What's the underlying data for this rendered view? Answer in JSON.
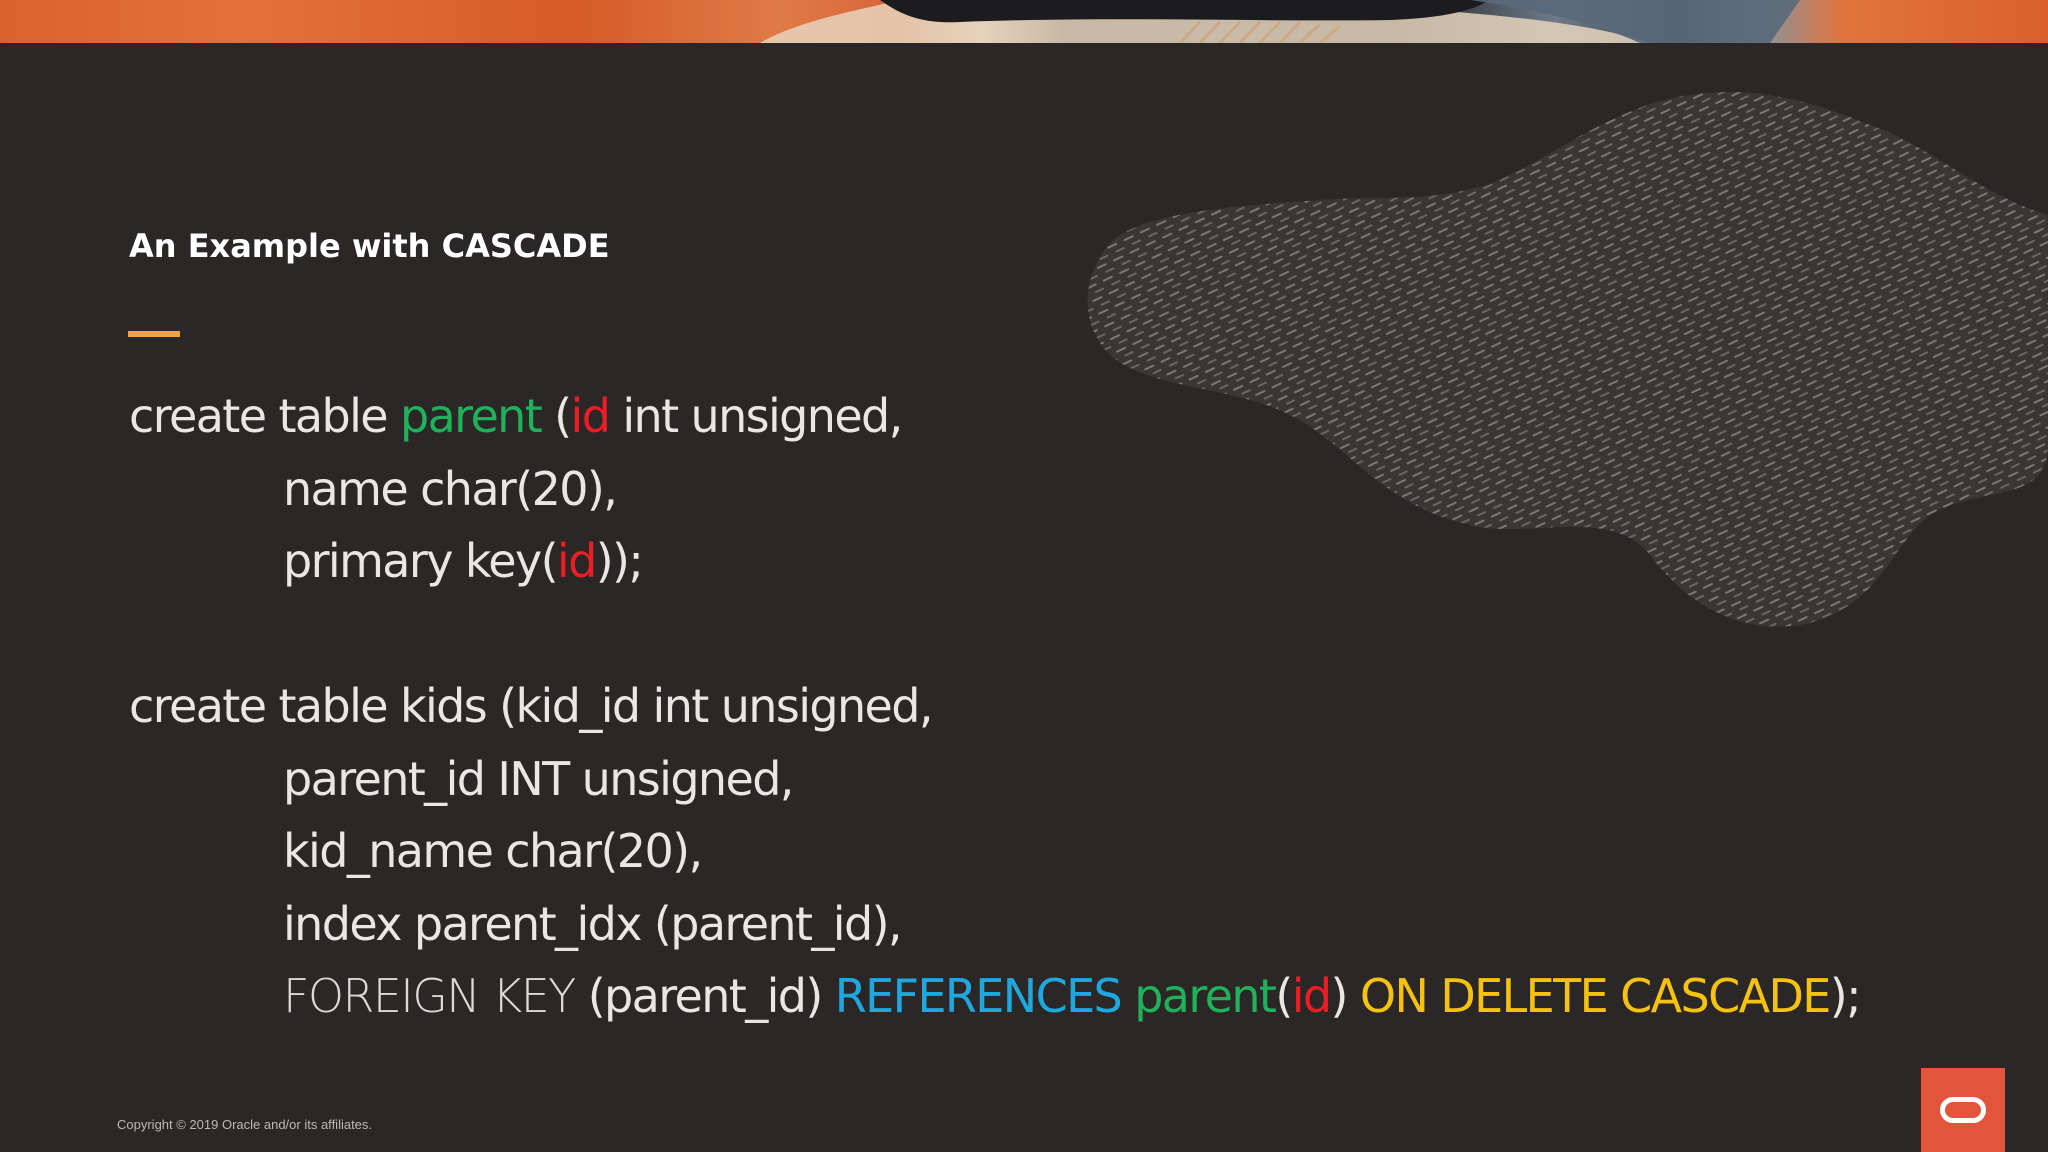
{
  "slide": {
    "title": "An Example with CASCADE",
    "copyright": "Copyright © 2019 Oracle and/or its affiliates.",
    "logo": "oracle-logo-icon"
  },
  "colors": {
    "background": "#2a2726",
    "accent": "#f0a23b",
    "keyword_green": "#1fb25a",
    "keyword_red": "#ee1c25",
    "keyword_blue": "#1fa7e0",
    "keyword_yellow": "#f5c20f",
    "logo_red": "#e3543d"
  },
  "code": {
    "l1": {
      "a": "create table ",
      "b": "parent",
      "c": " (",
      "d": "id",
      "e": " int unsigned,"
    },
    "l2": "name char(20),",
    "l3": {
      "a": "primary key(",
      "b": "id",
      "c": "));"
    },
    "l4": "create table kids (kid_id int unsigned,",
    "l5": "parent_id INT unsigned,",
    "l6": "kid_name char(20),",
    "l7": "index parent_idx (parent_id),",
    "l8": {
      "a": "FOREIGN KEY",
      "b": " (parent_id) ",
      "c": "REFERENCES",
      "d": " ",
      "e": "parent",
      "f": "(",
      "g": "id",
      "h": ") ",
      "i": "ON DELETE CASCADE",
      "j": ");"
    }
  }
}
